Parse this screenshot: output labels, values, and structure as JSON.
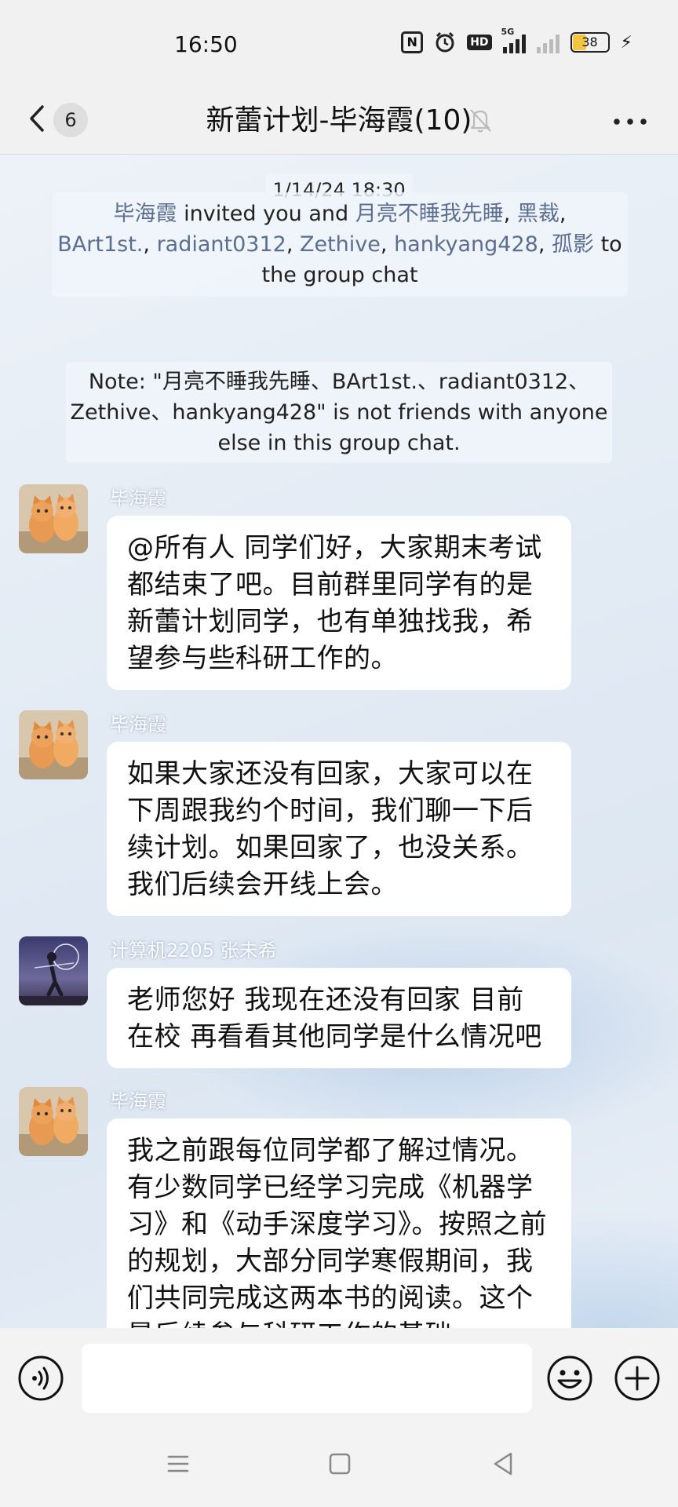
{
  "status_bar": {
    "time": "16:50",
    "battery": "38",
    "network": "5G"
  },
  "header": {
    "unread_count": "6",
    "title": "新蕾计划-毕海霞(10)"
  },
  "chat": {
    "timestamp": "1/14/24 18:30",
    "system_invite": {
      "inviter": "毕海霞",
      "text1": " invited you and ",
      "u1": "月亮不睡我先睡",
      "u2": "黑裁",
      "u3": "BArt1st.",
      "u4": "radiant0312",
      "u5": "Zethive",
      "u6": "hankyang428",
      "u7": "孤影",
      "sep": ", ",
      "text_end1": " to",
      "text_end2": "the group chat"
    },
    "system_note": "Note: \"月亮不睡我先睡、BArt1st.、radiant0312、Zethive、hankyang428\" is not friends with anyone else in this group chat.",
    "messages": [
      {
        "sender": "毕海霞",
        "text": "@所有人  同学们好，大家期末考试都结束了吧。目前群里同学有的是新蕾计划同学，也有单独找我，希望参与些科研工作的。"
      },
      {
        "sender": "毕海霞",
        "text": "如果大家还没有回家，大家可以在下周跟我约个时间，我们聊一下后续计划。如果回家了，也没关系。我们后续会开线上会。"
      },
      {
        "sender": "计算机2205 张未希",
        "text": "老师您好 我现在还没有回家 目前在校 再看看其他同学是什么情况吧"
      },
      {
        "sender": "毕海霞",
        "text": "我之前跟每位同学都了解过情况。有少数同学已经学习完成《机器学习》和《动手深度学习》。按照之前的规划，大部分同学寒假期间，我们共同完成这两本书的阅读。这个是后续参与科研工作的基础。"
      }
    ]
  },
  "input": {
    "value": "",
    "placeholder": ""
  }
}
